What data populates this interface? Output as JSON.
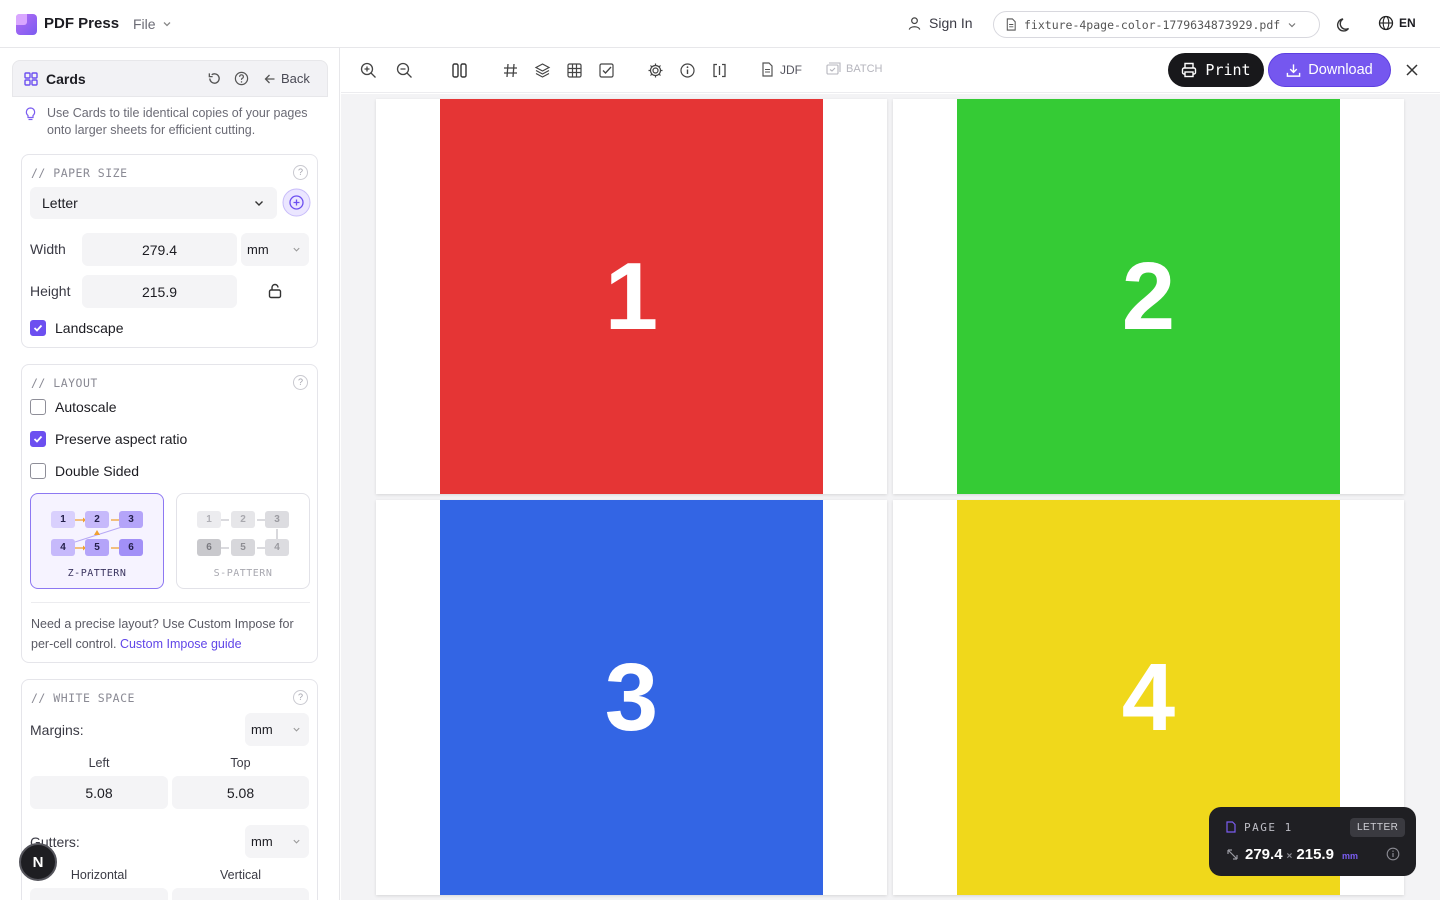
{
  "app": {
    "brand": "PDF Press",
    "file_menu": "File",
    "sign_in": "Sign In",
    "file_name": "fixture-4page-color-1779634873929.pdf",
    "language": "EN"
  },
  "sidebar": {
    "title": "Cards",
    "back_label": "Back",
    "tip": "Use Cards to tile identical copies of your pages onto larger sheets for efficient cutting.",
    "paper_size": {
      "section_title": "// PAPER SIZE",
      "preset": "Letter",
      "width_label": "Width",
      "width_value": "279.4",
      "unit": "mm",
      "height_label": "Height",
      "height_value": "215.9",
      "landscape_label": "Landscape",
      "landscape_checked": true
    },
    "layout": {
      "section_title": "// LAYOUT",
      "options": [
        {
          "label": "Autoscale",
          "checked": false
        },
        {
          "label": "Preserve aspect ratio",
          "checked": true
        },
        {
          "label": "Double Sided",
          "checked": false
        }
      ],
      "patterns": [
        {
          "label": "Z-PATTERN",
          "selected": true
        },
        {
          "label": "S-PATTERN",
          "selected": false
        }
      ],
      "description": "Need a precise layout? Use Custom Impose for per-cell control.",
      "guide_link": "Custom Impose guide"
    },
    "white_space": {
      "section_title": "// WHITE SPACE",
      "margins_label": "Margins:",
      "margins_unit": "mm",
      "left_label": "Left",
      "left_value": "5.08",
      "top_label": "Top",
      "top_value": "5.08",
      "gutters_label": "Gutters:",
      "gutters_unit": "mm",
      "horizontal_label": "Horizontal",
      "vertical_label": "Vertical"
    },
    "avatar_letter": "N"
  },
  "toolbar": {
    "jdf_label": "JDF",
    "batch_label": "BATCH",
    "print_label": "Print",
    "download_label": "Download"
  },
  "preview": {
    "pages": [
      {
        "number": "1",
        "color": "#e53535"
      },
      {
        "number": "2",
        "color": "#35cb35"
      },
      {
        "number": "3",
        "color": "#3365e4"
      },
      {
        "number": "4",
        "color": "#f0d81b"
      }
    ]
  },
  "page_badge": {
    "page_label": "PAGE 1",
    "size_label": "LETTER",
    "width": "279.4",
    "times": "×",
    "height": "215.9",
    "unit": "mm"
  },
  "colors": {
    "accent": "#7557ef",
    "dark": "#18181b"
  }
}
